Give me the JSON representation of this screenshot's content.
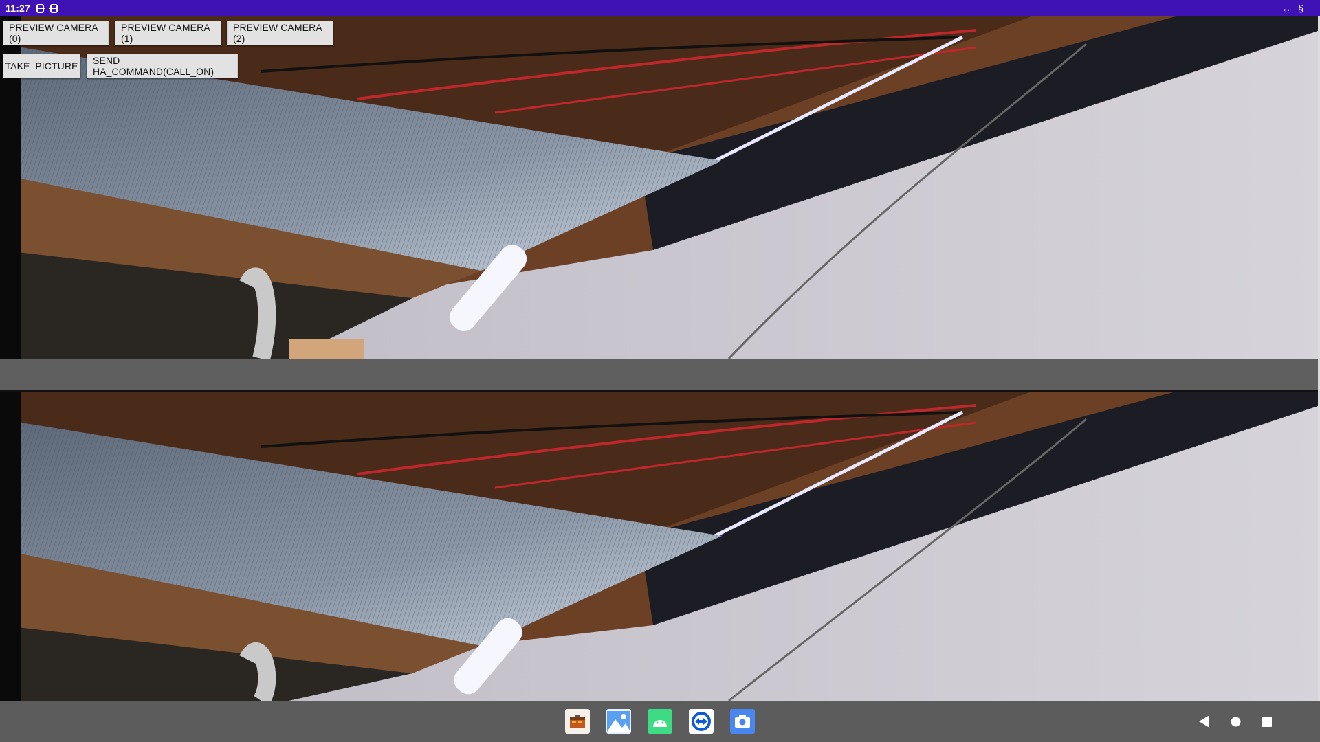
{
  "status_bar": {
    "time": "11:27",
    "right_icons": [
      "code-arrows-icon",
      "signal-icon"
    ]
  },
  "buttons": {
    "preview_camera_0": "PREVIEW CAMERA (0)",
    "preview_camera_1": "PREVIEW CAMERA (1)",
    "preview_camera_2": "PREVIEW CAMERA (2)",
    "take_picture": "TAKE_PICTURE",
    "send_command": "SEND HA_COMMAND(CALL_ON)"
  },
  "previews": [
    {
      "name": "camera-preview-top",
      "content": "camera-feed-image"
    },
    {
      "name": "camera-preview-bottom",
      "content": "camera-feed-image"
    }
  ],
  "taskbar": {
    "apps": [
      "toolbox-app-icon",
      "gallery-app-icon",
      "android-app-icon",
      "remote-app-icon",
      "camera-app-icon"
    ],
    "nav": [
      "back-icon",
      "home-icon",
      "recents-icon"
    ]
  },
  "colors": {
    "status_bar": "#3f12b6",
    "button_bg": "#e2e2e2",
    "taskbar_bg": "#5c5c5c"
  }
}
